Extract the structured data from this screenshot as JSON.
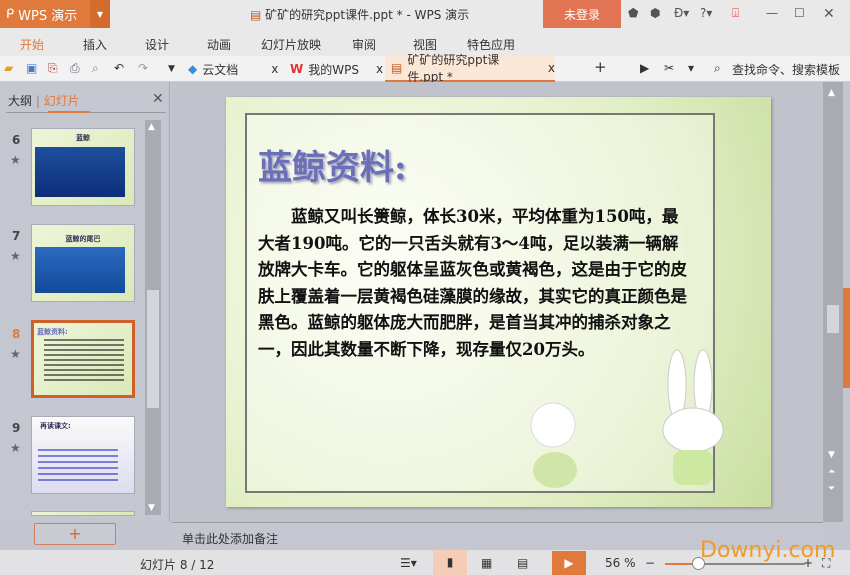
{
  "app": {
    "name": "WPS 演示",
    "title": "矿矿的研究ppt课件.ppt * - WPS 演示",
    "login": "未登录"
  },
  "ribbon": [
    "开始",
    "插入",
    "设计",
    "动画",
    "幻灯片放映",
    "审阅",
    "视图",
    "特色应用"
  ],
  "tabs": [
    {
      "label": "云文档"
    },
    {
      "label": "我的WPS"
    },
    {
      "label": "矿矿的研究ppt课件.ppt *"
    }
  ],
  "search": "查找命令、搜索模板",
  "panel": {
    "outline": "大纲",
    "slides": "幻灯片"
  },
  "thumbnails": [
    {
      "num": "6",
      "title": "蓝鲸"
    },
    {
      "num": "7",
      "title": "蓝鲸的尾巴"
    },
    {
      "num": "8",
      "title": "蓝鲸资料:"
    },
    {
      "num": "9",
      "title": "再读课文:"
    }
  ],
  "slide": {
    "title": "蓝鲸资料:",
    "body": "蓝鲸又叫长箦鲸，体长30米，平均体重为150吨，最大者190吨。它的一只舌头就有3～4吨，足以装满一辆解放牌大卡车。它的躯体呈蓝灰色或黄褐色，这是由于它的皮肤上覆盖着一层黄褐色硅藻膜的缘故，其实它的真正颜色是黑色。蓝鲸的躯体庞大而肥胖，是首当其冲的捕杀对象之一，因此其数量不断下降，现存量仅20万头。"
  },
  "notes": "单击此处添加备注",
  "status": {
    "slide": "幻灯片 8 / 12",
    "zoom": "56 %",
    "zoom_value": 56
  },
  "watermark": "Downyi.com",
  "colors": {
    "accent": "#e0793c"
  }
}
